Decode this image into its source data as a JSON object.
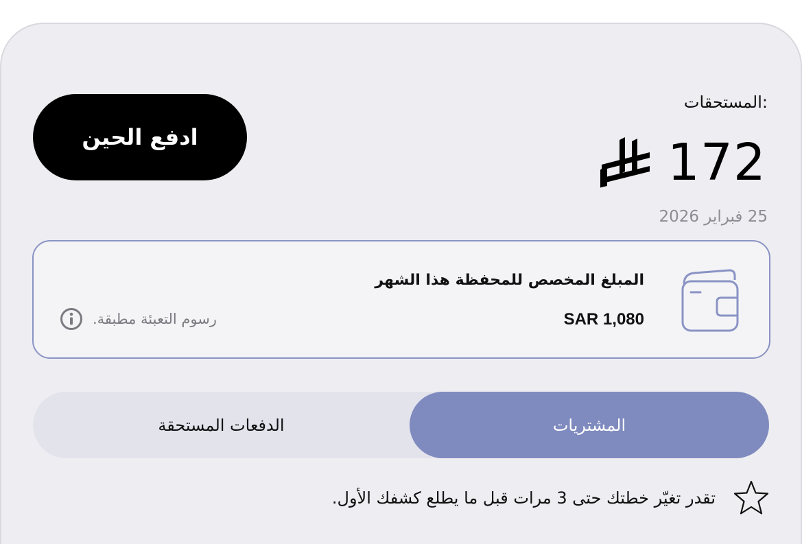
{
  "dues": {
    "label": ":المستحقات",
    "amount": "172",
    "currency_icon": "saudi-riyal-icon",
    "date": "25 فبراير 2026"
  },
  "actions": {
    "pay_now": "ادفع الحين"
  },
  "wallet": {
    "icon": "wallet-icon",
    "title": "المبلغ المخصص للمحفظة هذا الشهر",
    "amount": "SAR 1,080",
    "fees_note": "رسوم التعبئة مطبقة.",
    "info_icon": "info-icon"
  },
  "tabs": [
    {
      "label": "المشتريات",
      "active": true
    },
    {
      "label": "الدفعات المستحقة",
      "active": false
    }
  ],
  "tip": {
    "icon": "star-icon",
    "text": "تقدر تغيّر خطتك حتى 3 مرات قبل ما يطلع كشفك الأول."
  },
  "colors": {
    "accent": "#7f8abf",
    "card_border": "#8a93c4",
    "background": "#eeeef2",
    "pay_button": "#000000"
  }
}
